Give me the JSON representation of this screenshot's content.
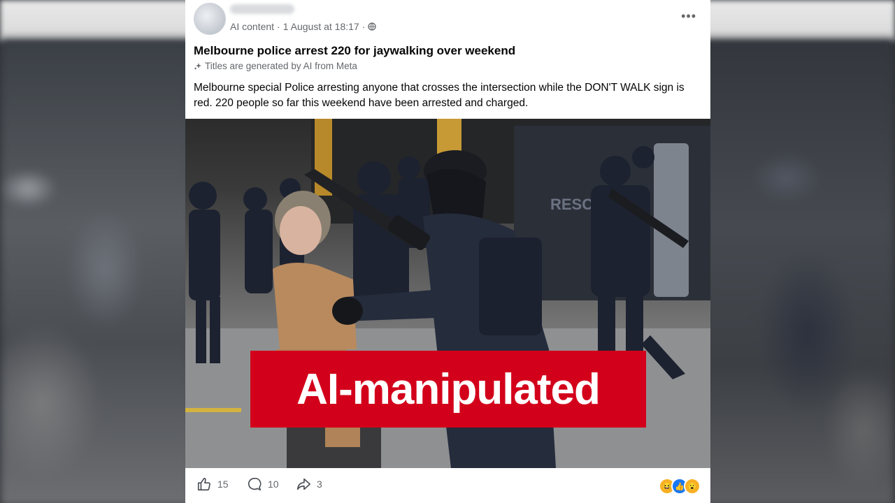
{
  "post": {
    "meta_label": "AI content",
    "separator": "·",
    "timestamp": "1 August at 18:17",
    "title": "Melbourne police arrest 220 for jaywalking over weekend",
    "ai_title_note": "Titles are generated by AI from Meta",
    "body": "Melbourne special Police arresting anyone that crosses the intersection while the DON'T WALK sign is red. 220 people so far this weekend have been arrested and charged.",
    "image_text": "RESC",
    "badge": "AI-manipulated"
  },
  "actions": {
    "likes": "15",
    "comments": "10",
    "shares": "3"
  },
  "colors": {
    "badge_red": "#d3001b",
    "like_blue": "#1877f2",
    "haha_yellow": "#f7b125"
  },
  "icons": [
    "globe-icon",
    "more-icon",
    "sparkle-icon",
    "like-icon",
    "comment-icon",
    "share-icon",
    "haha-reaction-icon",
    "like-reaction-icon",
    "wow-reaction-icon"
  ]
}
